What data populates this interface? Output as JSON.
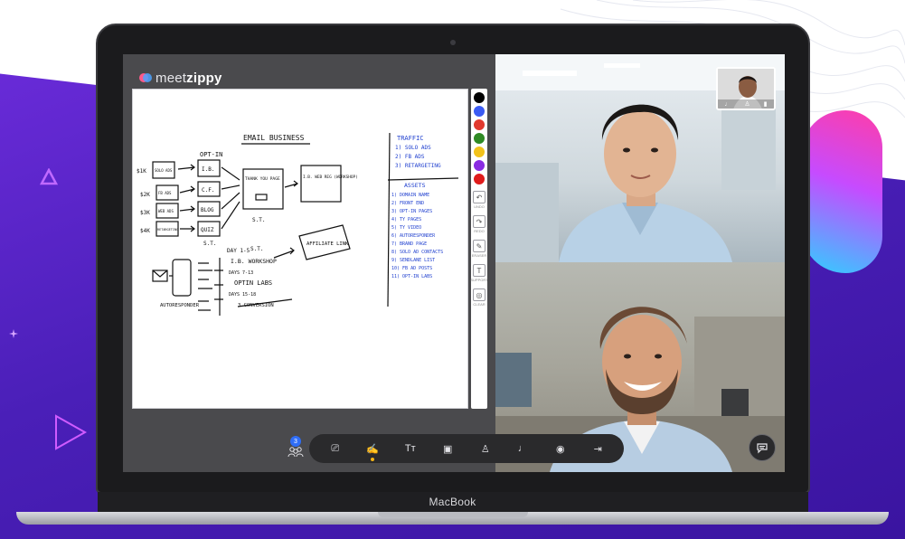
{
  "app": {
    "logo_prefix": "meet",
    "logo_suffix": "zippy",
    "device_label": "MacBook"
  },
  "colors": {
    "brand_purple": "#5a24c9",
    "accent_pink": "#ff3da8",
    "accent_cyan": "#2fd0ff",
    "toolbar_bg": "#2a2a2c",
    "badge_blue": "#2f6df6",
    "active_dot": "#f2b316"
  },
  "palette": {
    "swatches": [
      "#000000",
      "#3b5bf3",
      "#e23a2f",
      "#2f8a24",
      "#f2c21a",
      "#8a2be2",
      "#e01b1b"
    ],
    "tools": [
      {
        "icon": "undo-icon",
        "glyph": "↶",
        "label": "UNDO"
      },
      {
        "icon": "redo-icon",
        "glyph": "↷",
        "label": "REDO"
      },
      {
        "icon": "eraser-icon",
        "glyph": "✎",
        "label": "ERASER"
      },
      {
        "icon": "text-icon",
        "glyph": "T",
        "label": "SUPPORT"
      },
      {
        "icon": "clear-icon",
        "glyph": "◎",
        "label": "CLEAR"
      }
    ]
  },
  "whiteboard": {
    "title": "EMAIL BUSINESS",
    "optin": "OPT-IN",
    "row_labels": [
      "$1K",
      "$2K",
      "$3K",
      "$4K"
    ],
    "sources": [
      "SOLO ADS",
      "FB ADS",
      "WEB ADS",
      "RETARGETING"
    ],
    "mid_boxes": [
      "I.B.",
      "C.F.",
      "BLOG",
      "QUIZ"
    ],
    "thank_you": "THANK YOU PAGE",
    "st_1": "S.T.",
    "webreg": "I.B. WEB REG (WORKSHOP)",
    "st_2": "S.T.",
    "st_3": "S.T.",
    "affiliate": "AFFILIATE LINK",
    "day": "DAY 1-5",
    "workshop": "I.B. WORKSHOP",
    "days_2": "DAYS 7-13",
    "optinlabs": "OPTIN LABS",
    "days_3": "DAYS 15-18",
    "conversion": "3 CONVERSION",
    "autoresponder": "AUTORESPONDER",
    "traffic_title": "TRAFFIC",
    "traffic": [
      "1) SOLO ADS",
      "2) FB ADS",
      "3) RETARGETING"
    ],
    "assets_title": "ASSETS",
    "assets": [
      "1) DOMAIN NAME",
      "2) FRONT END",
      "3) OPT-IN PAGES",
      "4) TY PAGES",
      "5) TY VIDEO",
      "6) AUTORESPONDER",
      "7) BRAND PAGE",
      "8) SOLO AD CONTACTS",
      "9) SENDLANE LIST",
      "10) FB AD POSTS",
      "11) OPT-IN LABS"
    ]
  },
  "participants": {
    "count": "3"
  },
  "toolbar": {
    "buttons": [
      {
        "icon": "share-screen-icon",
        "glyph": "⎚"
      },
      {
        "icon": "whiteboard-icon",
        "glyph": "✍"
      },
      {
        "icon": "text-tool-icon",
        "glyph": "Tт"
      },
      {
        "icon": "camera-icon",
        "glyph": "▣"
      },
      {
        "icon": "person-icon",
        "glyph": "♙"
      },
      {
        "icon": "microphone-icon",
        "glyph": "♩"
      },
      {
        "icon": "view-icon",
        "glyph": "◉"
      },
      {
        "icon": "exit-icon",
        "glyph": "⇥"
      }
    ]
  }
}
